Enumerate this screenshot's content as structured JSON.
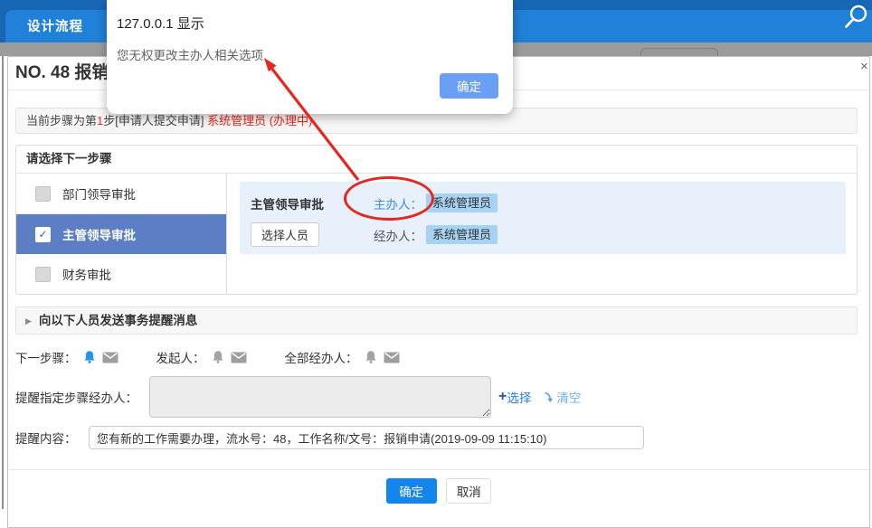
{
  "palette": {
    "topbar_blue": "#2181d8",
    "selected_step_blue": "#5b7ec4",
    "person_chip_blue": "#a6d2f4",
    "detail_box_blue": "#e7f0fb",
    "link_blue": "#3a8ee6",
    "primary_button_blue": "#1285ef",
    "alert_ok_blue": "#69a0f6",
    "status_red": "#e8291c",
    "annotation_red": "#e5271d"
  },
  "topbar": {
    "tab_label": "设计流程"
  },
  "alert": {
    "title": "127.0.0.1 显示",
    "message": "您无权更改主办人相关选项",
    "ok_label": "确定"
  },
  "modal": {
    "title": "NO. 48 报销",
    "close_glyph": "×",
    "current_step": {
      "prefix": "当前步骤为第",
      "step_num": "1",
      "mid": "步[申请人提交申请] ",
      "handler": "系统管理员 (办理中)"
    },
    "next_step": {
      "header": "请选择下一步骤",
      "check_glyph": "✓",
      "options": [
        {
          "label": "部门领导审批",
          "checked": false
        },
        {
          "label": "主管领导审批",
          "checked": true
        },
        {
          "label": "财务审批",
          "checked": false
        }
      ],
      "detail": {
        "step_name": "主管领导审批",
        "owner_link": "主办人：",
        "owner_value": "系统管理员",
        "select_button": "选择人员",
        "agent_label": "经办人：",
        "agent_value": "系统管理员"
      }
    },
    "notify": {
      "header": "向以下人员发送事务提醒消息",
      "collapse_glyph": "▶",
      "targets": [
        {
          "label": "下一步骤："
        },
        {
          "label": "发起人："
        },
        {
          "label": "全部经办人："
        }
      ],
      "assign_label": "提醒指定步骤经办人：",
      "plus_glyph": "+",
      "select_link": "选择",
      "clear_link": "清空",
      "content_label": "提醒内容：",
      "content_value": "您有新的工作需要办理，流水号：48，工作名称/文号：报销申请(2019-09-09 11:15:10)"
    },
    "footer": {
      "ok_label": "确定",
      "cancel_label": "取消"
    }
  }
}
